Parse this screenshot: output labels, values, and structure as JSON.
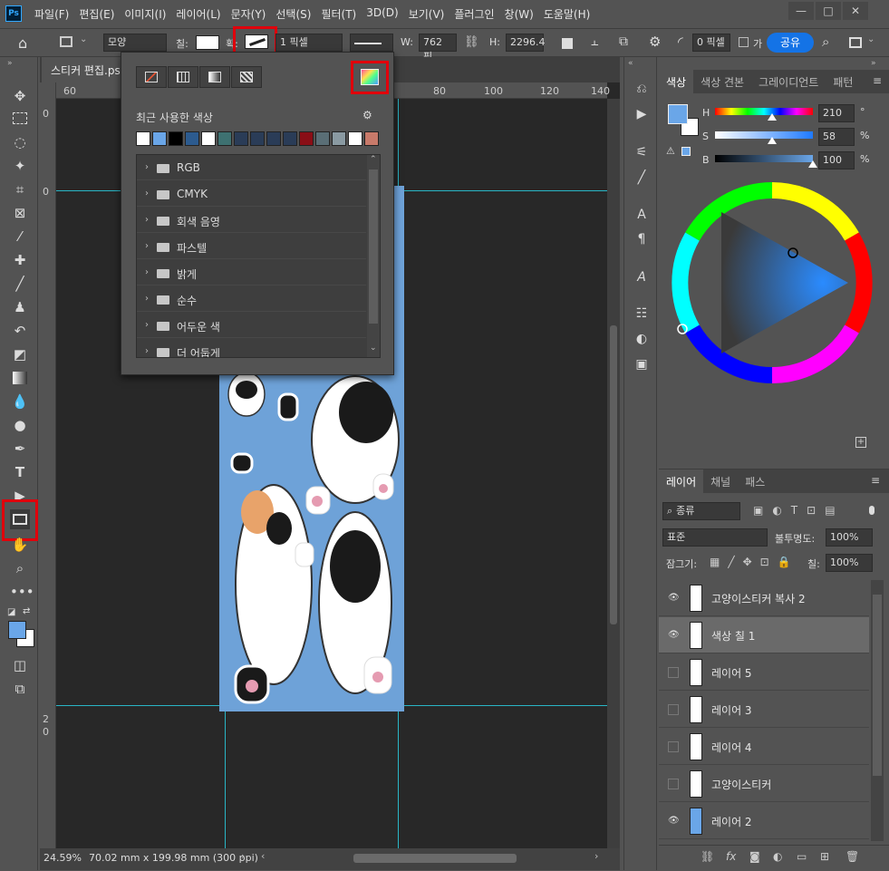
{
  "app": {
    "logo": "Ps"
  },
  "menu": [
    "파일(F)",
    "편집(E)",
    "이미지(I)",
    "레이어(L)",
    "문자(Y)",
    "선택(S)",
    "필터(T)",
    "3D(D)",
    "보기(V)",
    "플러그인",
    "창(W)",
    "도움말(H)"
  ],
  "window_controls": {
    "minimize": "—",
    "maximize": "□",
    "close": "✕"
  },
  "options": {
    "shape_mode": "모양",
    "fill_label": "칠:",
    "stroke_label": "획:",
    "stroke_width": "1 픽셀",
    "w_label": "W:",
    "w_value": "762 픽",
    "h_label": "H:",
    "h_value": "2296.4",
    "radius_value": "0 픽셀",
    "align_edges_label": "가",
    "share_label": "공유"
  },
  "document": {
    "tab_title": "스티커 편집.ps",
    "status_zoom": "24.59%",
    "status_info": "70.02 mm x 199.98 mm (300 ppi)",
    "ruler_h": [
      "60",
      "80",
      "100",
      "120",
      "140"
    ],
    "ruler_v": [
      "0",
      "2",
      "0",
      "0"
    ]
  },
  "popup": {
    "recent_label": "최근 사용한 색상",
    "recent_swatches": [
      "#ffffff",
      "#6aa6e8",
      "#000000",
      "#2c5b8f",
      "#ffffff",
      "#3e7171",
      "#2a3c57",
      "#2a3c57",
      "#2a3c57",
      "#2a3c57",
      "#8a0e16",
      "#5a6e76",
      "#8a9aa2",
      "#ffffff",
      "#c87a6a"
    ],
    "folders": [
      "RGB",
      "CMYK",
      "회색 음영",
      "파스텔",
      "밝게",
      "순수",
      "어두운 색",
      "더 어둡게"
    ]
  },
  "color_panel": {
    "tabs": [
      "색상",
      "색상 견본",
      "그레이디언트",
      "패턴"
    ],
    "h_label": "H",
    "h_value": "210",
    "h_unit": "°",
    "s_label": "S",
    "s_value": "58",
    "s_unit": "%",
    "b_label": "B",
    "b_value": "100",
    "b_unit": "%",
    "foreground": "#6aa6e8",
    "h_fraction": 0.58,
    "s_fraction": 0.58,
    "b_fraction": 1.0
  },
  "layers_panel": {
    "tabs": [
      "레이어",
      "채널",
      "패스"
    ],
    "filter_kind": "종류",
    "blend_mode": "표준",
    "opacity_label": "불투명도:",
    "opacity_value": "100%",
    "lock_label": "잠그기:",
    "fill_label": "칠:",
    "fill_value": "100%",
    "layers": [
      {
        "name": "고양이스티커 복사 2",
        "visible": true
      },
      {
        "name": "색상 칠 1",
        "visible": true
      },
      {
        "name": "레이어 5",
        "visible": false
      },
      {
        "name": "레이어 3",
        "visible": false
      },
      {
        "name": "레이어 4",
        "visible": false
      },
      {
        "name": "고양이스티커",
        "visible": false
      },
      {
        "name": "레이어 2",
        "visible": true
      }
    ]
  }
}
